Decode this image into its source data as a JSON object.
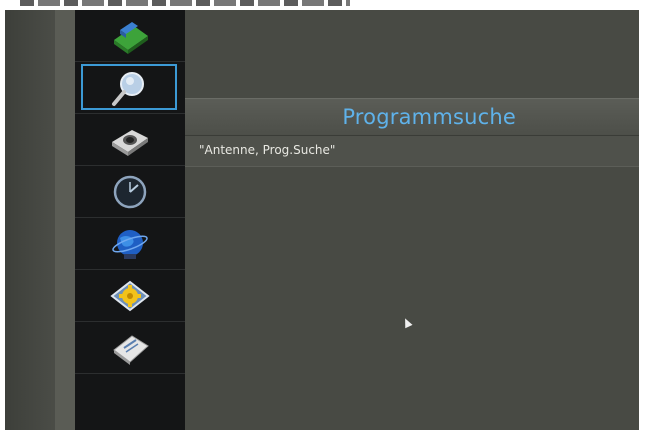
{
  "menu": {
    "items": [
      {
        "id": "picture",
        "icon": "picture-book-icon"
      },
      {
        "id": "search",
        "icon": "search-icon",
        "selected": true
      },
      {
        "id": "setup",
        "icon": "camera-icon"
      },
      {
        "id": "timer",
        "icon": "clock-icon"
      },
      {
        "id": "network",
        "icon": "globe-icon"
      },
      {
        "id": "options",
        "icon": "gear-icon"
      },
      {
        "id": "info",
        "icon": "document-icon"
      }
    ]
  },
  "panel": {
    "title": "Programmsuche",
    "subtitle": "\"Antenne, Prog.Suche\""
  },
  "colors": {
    "accent": "#5fb2ea",
    "selection": "#3c9ad6",
    "sidebar": "#141516",
    "background": "#4a4c46"
  }
}
